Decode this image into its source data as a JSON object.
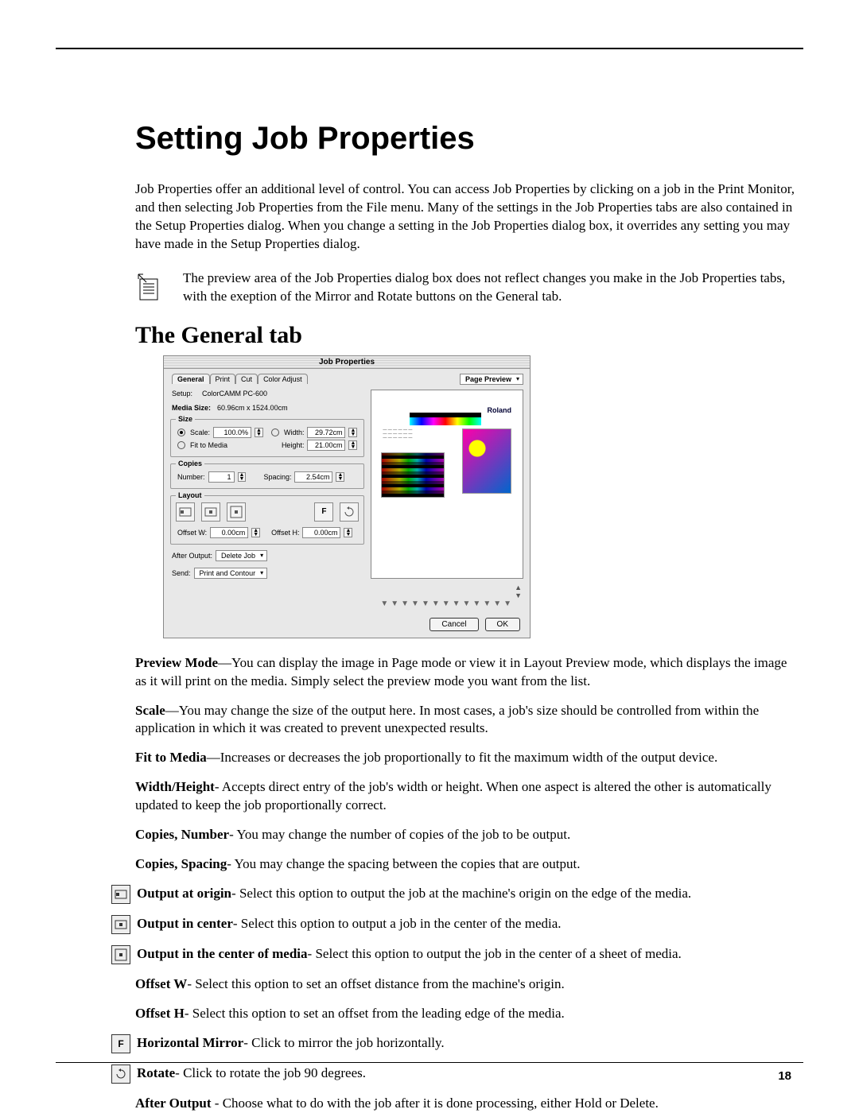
{
  "title": "Setting Job Properties",
  "intro": "Job Properties offer an additional level of control. You can access Job Properties by clicking on a job in the Print Monitor, and then selecting Job Properties from the File menu. Many of the settings in the Job Properties tabs are also contained in the Setup Properties dialog. When you change a setting in the Job Properties dialog box, it overrides any setting you may have made in the Setup Properties dialog.",
  "note": "The preview area of the Job Properties dialog box does not reflect changes you make in the Job Properties tabs, with the exeption of the Mirror and Rotate buttons on the General tab.",
  "subsection": "The General tab",
  "dialog": {
    "title": "Job Properties",
    "tabs": [
      "General",
      "Print",
      "Cut",
      "Color Adjust"
    ],
    "setup_label": "Setup:",
    "setup_value": "ColorCAMM PC-600",
    "media_size_label": "Media Size:",
    "media_size_value": "60.96cm x 1524.00cm",
    "size": {
      "legend": "Size",
      "scale_label": "Scale:",
      "scale_value": "100.0%",
      "width_label": "Width:",
      "width_value": "29.72cm",
      "height_label": "Height:",
      "height_value": "21.00cm",
      "fit_label": "Fit to Media"
    },
    "copies": {
      "legend": "Copies",
      "number_label": "Number:",
      "number_value": "1",
      "spacing_label": "Spacing:",
      "spacing_value": "2.54cm"
    },
    "layout": {
      "legend": "Layout",
      "mirror_label": "F",
      "offset_w_label": "Offset W:",
      "offset_w_value": "0.00cm",
      "offset_h_label": "Offset H:",
      "offset_h_value": "0.00cm"
    },
    "after_output_label": "After Output:",
    "after_output_value": "Delete Job",
    "send_label": "Send:",
    "send_value": "Print and Contour",
    "preview_mode_label": "Page Preview",
    "brand": "Roland",
    "cancel": "Cancel",
    "ok": "OK"
  },
  "defs": {
    "preview_mode_b": "Preview Mode",
    "preview_mode": "—You can display the image in Page mode or view it in Layout Preview mode, which displays the image as it will print on the media. Simply select the preview mode you want from the list.",
    "scale_b": "Scale",
    "scale": "—You may change the size of the output here. In most cases, a job's size should be controlled from within the application in which it was created to prevent unexpected results.",
    "fit_b": "Fit to Media",
    "fit": "—Increases or decreases the job proportionally to fit the maximum width of the output device.",
    "wh_b": "Width/Height",
    "wh": "- Accepts direct entry of the job's width or height. When one aspect is altered the other is automatically updated to keep the job proportionally correct.",
    "cn_b": "Copies, Number",
    "cn": "- You may change the number of copies of the job to be output.",
    "cs_b": "Copies, Spacing",
    "cs": "- You may change the spacing between the copies that are output.",
    "oo_b": "Output at origin",
    "oo": "- Select this option to output the job at the machine's origin on the edge of the media.",
    "oc_b": "Output in center",
    "oc": "- Select this option to output a job in the center of the media.",
    "ocm_b": "Output in the center of media",
    "ocm": "- Select this option to output the job in the center of a sheet of media.",
    "ow_b": "Offset W",
    "ow": "- Select this option to set an offset distance from the machine's origin.",
    "oh_b": "Offset H",
    "oh": "- Select this option to set an offset from the leading edge of the media.",
    "hm_b": "Horizontal Mirror",
    "hm": "- Click to mirror the job horizontally.",
    "rot_b": "Rotate",
    "rot": "- Click to rotate the job 90 degrees.",
    "ao_b": "After Output ",
    "ao": "- Choose what to do with the job after it is done processing, either Hold or Delete."
  },
  "page_number": "18"
}
